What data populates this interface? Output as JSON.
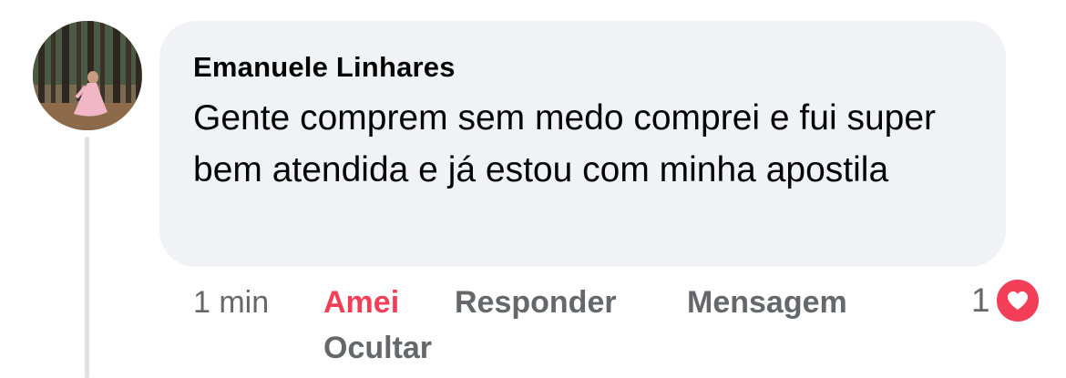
{
  "comment": {
    "author": "Emanuele Linhares",
    "text": "Gente comprem sem medo comprei e fui super bem atendida e já estou com minha apostila",
    "time": "1 min",
    "reaction_count": "1"
  },
  "actions": {
    "love_label": "Amei",
    "reply_label": "Responder",
    "message_label": "Mensagem",
    "hide_label": "Ocultar"
  },
  "icons": {
    "reaction": "heart-icon",
    "avatar": "avatar-photo"
  },
  "colors": {
    "bubble_bg": "#f0f2f5",
    "love_accent": "#f33e58",
    "secondary_text": "#65676b",
    "primary_text": "#050505",
    "thread_line": "#dfe1e5"
  }
}
